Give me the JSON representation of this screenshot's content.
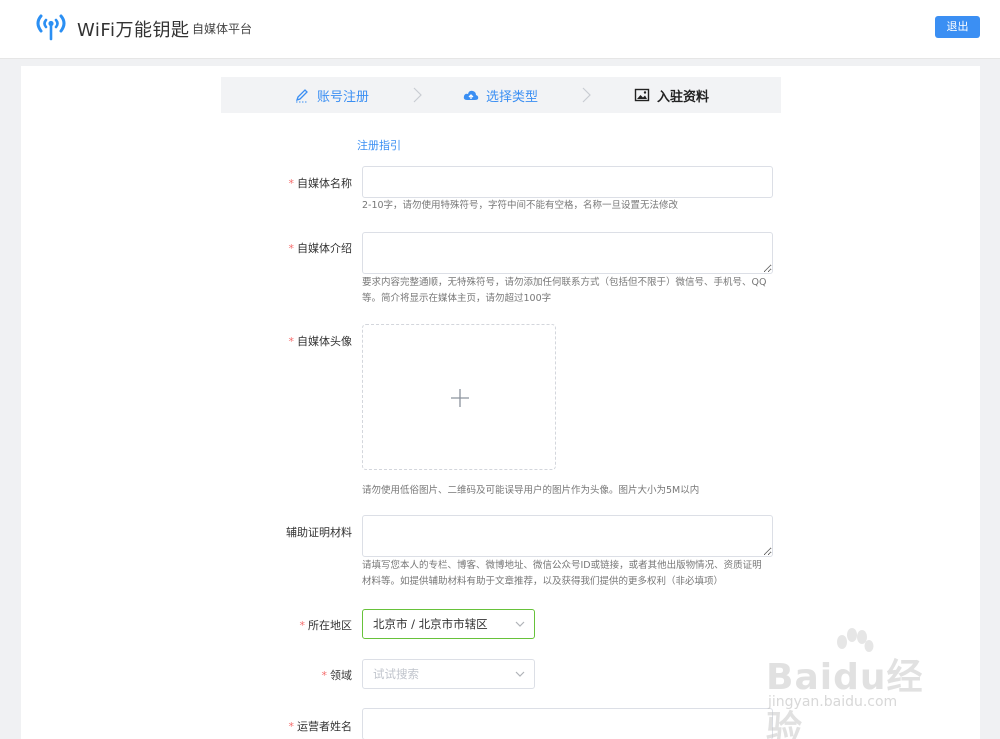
{
  "header": {
    "logo_text": "WiFi万能钥匙",
    "logo_sub": "自媒体平台",
    "logout_label": "退出",
    "logo_icon": "wifi-signal-icon"
  },
  "steps": [
    {
      "label": "账号注册",
      "icon": "pen-icon",
      "state": "done"
    },
    {
      "label": "选择类型",
      "icon": "cloud-upload-icon",
      "state": "done"
    },
    {
      "label": "入驻资料",
      "icon": "picture-icon",
      "state": "current"
    }
  ],
  "guide_link": "注册指引",
  "form": {
    "name": {
      "label": "自媒体名称",
      "required": true,
      "value": "",
      "hint": "2-10字，请勿使用特殊符号，字符中间不能有空格，名称一旦设置无法修改"
    },
    "intro": {
      "label": "自媒体介绍",
      "required": true,
      "value": "",
      "hint_1": "要求内容完整通顺，无特殊符号，请勿添加任何联系方式（包括但不限于）微信号、手机号、QQ",
      "hint_2": "等。简介将显示在媒体主页，请勿超过100字"
    },
    "avatar": {
      "label": "自媒体头像",
      "required": true,
      "hint": "请勿使用低俗图片、二维码及可能误导用户的图片作为头像。图片大小为5M以内"
    },
    "material": {
      "label": "辅助证明材料",
      "required": false,
      "value": "",
      "hint_1": "请填写您本人的专栏、博客、微博地址、微信公众号ID或链接，或者其他出版物情况、资质证明",
      "hint_2": "材料等。如提供辅助材料有助于文章推荐，以及获得我们提供的更多权利（非必填项）"
    },
    "region": {
      "label": "所在地区",
      "required": true,
      "value": "北京市 / 北京市市辖区"
    },
    "field": {
      "label": "领域",
      "required": true,
      "placeholder": "试试搜索"
    },
    "operator": {
      "label": "运营者姓名",
      "required": true,
      "value": ""
    }
  },
  "required_mark": "*",
  "watermark": {
    "text": "Baidu经验",
    "url": "jingyan.baidu.com"
  },
  "colors": {
    "accent": "#3b8ff3",
    "required": "#f56c6c",
    "active_border": "#67c23a"
  }
}
